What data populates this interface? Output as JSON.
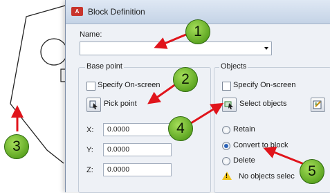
{
  "dialog": {
    "title": "Block Definition",
    "app_icon": "A",
    "name_label": "Name:",
    "name_value": ""
  },
  "base_point": {
    "group_label": "Base point",
    "specify_on_screen": "Specify On-screen",
    "pick_point": "Pick point",
    "x_label": "X:",
    "x_value": "0.0000",
    "y_label": "Y:",
    "y_value": "0.0000",
    "z_label": "Z:",
    "z_value": "0.0000"
  },
  "objects": {
    "group_label": "Objects",
    "specify_on_screen": "Specify On-screen",
    "select_objects": "Select objects",
    "retain": "Retain",
    "convert_to_block": "Convert to block",
    "delete": "Delete",
    "selected": "convert_to_block",
    "status": "No objects selec"
  },
  "callouts": [
    "1",
    "2",
    "3",
    "4",
    "5"
  ],
  "colors": {
    "arrow": "#e0141b",
    "callout_fill": "#7cc23a",
    "accent": "#2a62b8"
  }
}
